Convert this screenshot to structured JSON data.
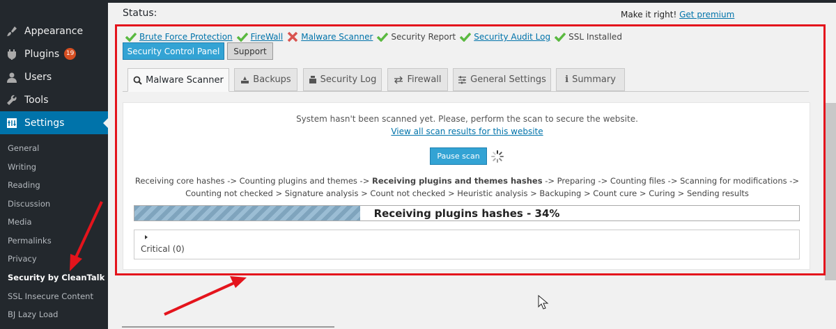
{
  "sidebar": {
    "items": [
      {
        "label": "Appearance",
        "icon": "paintbrush-icon"
      },
      {
        "label": "Plugins",
        "icon": "plugin-icon",
        "badge": "19"
      },
      {
        "label": "Users",
        "icon": "user-icon"
      },
      {
        "label": "Tools",
        "icon": "wrench-icon"
      },
      {
        "label": "Settings",
        "icon": "settings-icon",
        "active": true
      }
    ],
    "submenu": [
      "General",
      "Writing",
      "Reading",
      "Discussion",
      "Media",
      "Permalinks",
      "Privacy",
      "Security by CleanTalk",
      "SSL Insecure Content",
      "BJ Lazy Load"
    ]
  },
  "status_label": "Status:",
  "premium": {
    "text": "Make it right!",
    "link": "Get premium"
  },
  "status_items": [
    {
      "label": "Brute Force Protection",
      "state": "ok",
      "link": true
    },
    {
      "label": "FireWall",
      "state": "ok",
      "link": true
    },
    {
      "label": "Malware Scanner",
      "state": "fail",
      "link": true
    },
    {
      "label": "Security Report",
      "state": "ok",
      "link": false
    },
    {
      "label": "Security Audit Log",
      "state": "ok",
      "link": true
    },
    {
      "label": "SSL Installed",
      "state": "ok",
      "link": false
    }
  ],
  "buttons": {
    "control_panel": "Security Control Panel",
    "support": "Support"
  },
  "tabs": [
    {
      "label": "Malware Scanner",
      "icon": "search-icon",
      "active": true
    },
    {
      "label": "Backups",
      "icon": "backup-icon"
    },
    {
      "label": "Security Log",
      "icon": "log-icon"
    },
    {
      "label": "Firewall",
      "icon": "arrows-icon"
    },
    {
      "label": "General Settings",
      "icon": "sliders-icon"
    },
    {
      "label": "Summary",
      "icon": "info-icon"
    }
  ],
  "scanner": {
    "message": "System hasn't been scanned yet. Please, perform the scan to secure the website.",
    "link": "View all scan results for this website",
    "pause_button": "Pause scan",
    "stages_line1_before": "Receiving core hashes -> Counting plugins and themes -> ",
    "stages_line1_bold": "Receiving plugins and themes hashes",
    "stages_line1_after": " -> Preparing -> Counting files -> Scanning for modifications ->",
    "stages_line2": "Counting not checked  > Signature analysis  > Count not checked  > Heuristic analysis  > Backuping  > Count cure  > Curing  > Sending results",
    "progress_text": "Receiving plugins hashes - 34%",
    "progress_fraction": 0.34,
    "accordion_label": "Critical (0)"
  },
  "colors": {
    "accent": "#0073aa",
    "highlight": "#e4141c",
    "ok": "#5ab940",
    "fail": "#d9534f"
  }
}
